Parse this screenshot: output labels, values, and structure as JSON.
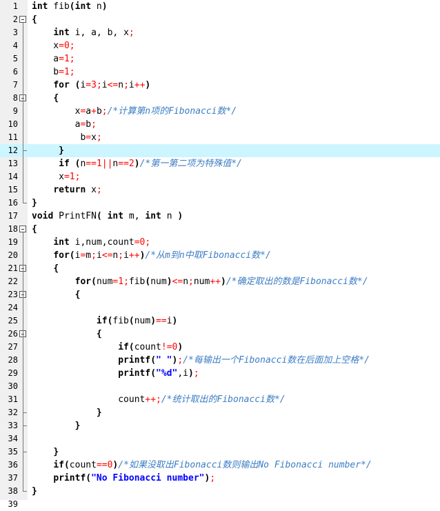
{
  "lines": [
    {
      "n": "1",
      "t": "int fib(int n)"
    },
    {
      "n": "2",
      "t": "{"
    },
    {
      "n": "3",
      "t": "    int i, a, b, x;"
    },
    {
      "n": "4",
      "t": "    x=0;"
    },
    {
      "n": "5",
      "t": "    a=1;"
    },
    {
      "n": "6",
      "t": "    b=1;"
    },
    {
      "n": "7",
      "t": "    for (i=3;i<=n;i++)"
    },
    {
      "n": "8",
      "t": "    {"
    },
    {
      "n": "9",
      "t": "        x=a+b;/*计算第n项的Fibonacci数*/"
    },
    {
      "n": "10",
      "t": "        a=b;"
    },
    {
      "n": "11",
      "t": "         b=x;"
    },
    {
      "n": "12",
      "t": "     }"
    },
    {
      "n": "13",
      "t": "     if (n==1||n==2)/*第一第二项为特殊值*/"
    },
    {
      "n": "14",
      "t": "     x=1;"
    },
    {
      "n": "15",
      "t": "    return x;"
    },
    {
      "n": "16",
      "t": "}"
    },
    {
      "n": "17",
      "t": "void PrintFN( int m, int n )"
    },
    {
      "n": "18",
      "t": "{"
    },
    {
      "n": "19",
      "t": "    int i,num,count=0;"
    },
    {
      "n": "20",
      "t": "    for(i=m;i<=n;i++)/*从m到n中取Fibonacci数*/"
    },
    {
      "n": "21",
      "t": "    {"
    },
    {
      "n": "22",
      "t": "        for(num=1;fib(num)<=n;num++)/*确定取出的数是Fibonacci数*/"
    },
    {
      "n": "23",
      "t": "        {"
    },
    {
      "n": "24",
      "t": ""
    },
    {
      "n": "25",
      "t": "            if(fib(num)==i)"
    },
    {
      "n": "26",
      "t": "            {"
    },
    {
      "n": "27",
      "t": "                if(count!=0)"
    },
    {
      "n": "28",
      "t": "                printf(\" \");/*每输出一个Fibonacci数在后面加上空格*/"
    },
    {
      "n": "29",
      "t": "                printf(\"%d\",i);"
    },
    {
      "n": "30",
      "t": ""
    },
    {
      "n": "31",
      "t": "                count++;/*统计取出的Fibonacci数*/"
    },
    {
      "n": "32",
      "t": "            }"
    },
    {
      "n": "33",
      "t": "        }"
    },
    {
      "n": "34",
      "t": ""
    },
    {
      "n": "35",
      "t": "    }"
    },
    {
      "n": "36",
      "t": "    if(count==0)/*如果没取出Fibonacci数则输出No Fibonacci number*/"
    },
    {
      "n": "37",
      "t": "    printf(\"No Fibonacci number\");"
    },
    {
      "n": "38",
      "t": "}"
    },
    {
      "n": "39",
      "t": ""
    }
  ],
  "highlighted_line": "12",
  "fold_markers": [
    "2",
    "8",
    "18",
    "21",
    "23",
    "26"
  ],
  "colors": {
    "keyword": "#000000",
    "operator": "#ff0000",
    "string": "#0000ff",
    "comment": "#3b7dc4",
    "highlight": "#ccf5ff",
    "gutter": "#f0f0f0"
  }
}
